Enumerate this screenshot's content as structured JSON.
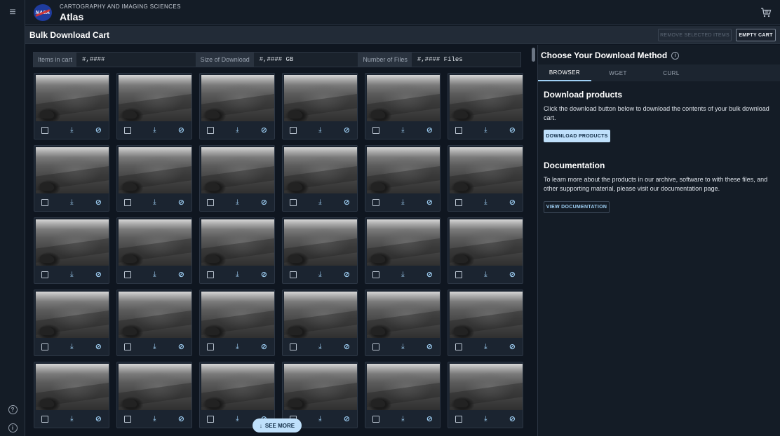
{
  "app": {
    "org": "CARTOGRAPHY AND IMAGING SCIENCES",
    "name": "Atlas",
    "logo_text": "NASA"
  },
  "rail": {
    "menu_icon": "menu-icon",
    "help_icon": "help-icon",
    "info_icon": "info-icon"
  },
  "header": {
    "cart_icon": "cart-icon"
  },
  "page": {
    "title": "Bulk Download Cart",
    "remove_selected_label": "REMOVE SELECTED ITEMS",
    "empty_cart_label": "EMPTY CART"
  },
  "stats": [
    {
      "label": "Items in cart",
      "value": "#,####"
    },
    {
      "label": "Size of Download",
      "value": "#,#### GB"
    },
    {
      "label": "Number of Files",
      "value": "#,#### Files"
    }
  ],
  "grid": {
    "rows": 5,
    "columns": 6,
    "card_actions": [
      "checkbox",
      "download-icon",
      "remove-from-cart-icon"
    ]
  },
  "see_more_label": "SEE MORE",
  "panel": {
    "title": "Choose Your Download Method",
    "tabs": [
      {
        "label": "BROWSER",
        "active": true
      },
      {
        "label": "WGET",
        "active": false
      },
      {
        "label": "CURL",
        "active": false
      }
    ],
    "download": {
      "title": "Download products",
      "text": "Click the download button below to download the contents of your bulk download cart.",
      "button": "DOWNLOAD PRODUCTS"
    },
    "documentation": {
      "title": "Documentation",
      "text": "To learn more about the products in our archive, software to with these files, and other supporting material, please visit our documentation page.",
      "button": "VIEW DOCUMENTATION"
    }
  },
  "colors": {
    "background": "#0f1620",
    "accent": "#9fd0f5",
    "accent_button": "#bfe0fb"
  }
}
